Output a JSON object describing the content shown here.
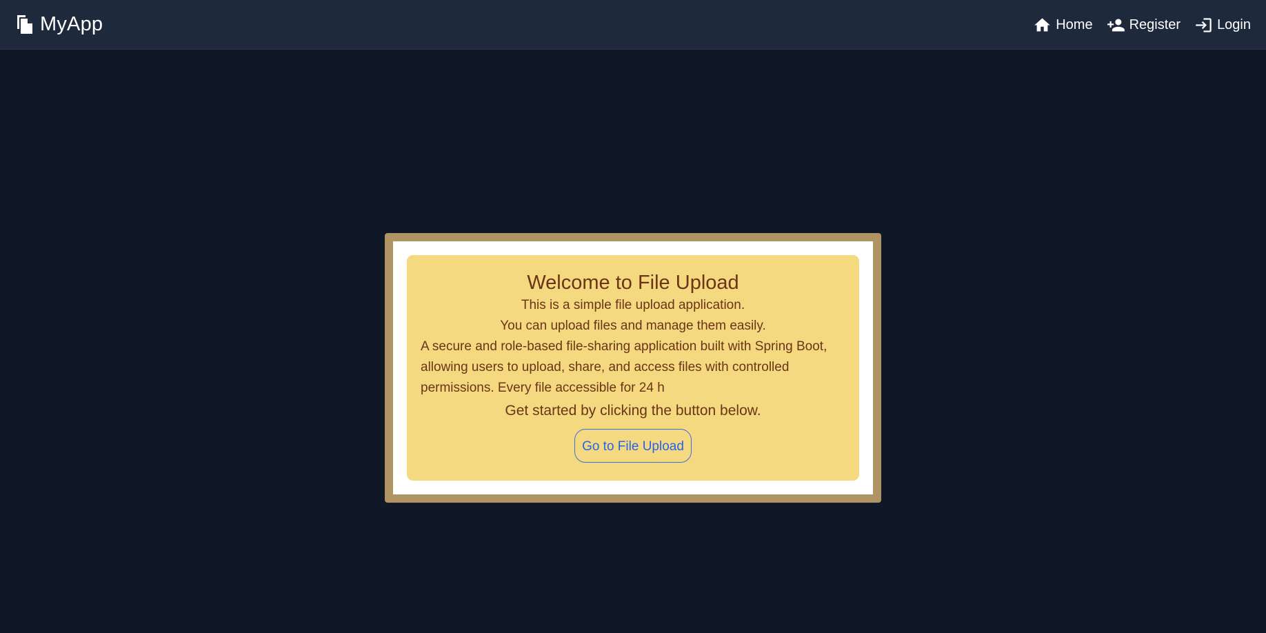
{
  "navbar": {
    "brand": "MyApp",
    "brand_icon": "files-icon",
    "links": [
      {
        "label": "Home",
        "icon": "home-icon"
      },
      {
        "label": "Register",
        "icon": "person-add-icon"
      },
      {
        "label": "Login",
        "icon": "login-icon"
      }
    ]
  },
  "card": {
    "title": "Welcome to File Upload",
    "line1": "This is a simple file upload application.",
    "line2": "You can upload files and manage them easily.",
    "description": "A secure and role-based file-sharing application built with Spring Boot, allowing users to upload, share, and access files with controlled permissions. Every file accessible for 24 h",
    "cta": "Get started by clicking the button below.",
    "button_label": "Go to File Upload"
  },
  "colors": {
    "page_background": "#101727",
    "navbar_background": "#1e293b",
    "frame": "#b09362",
    "card_background": "#f4d981",
    "card_text": "#6b3414",
    "button_accent": "#2563eb"
  }
}
